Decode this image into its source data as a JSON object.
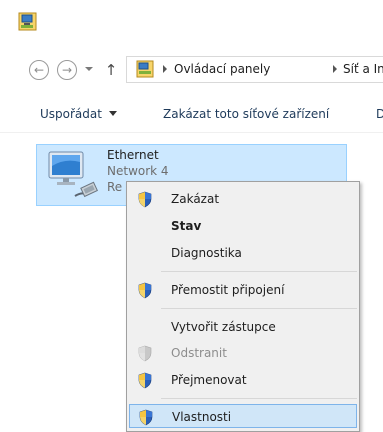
{
  "address": {
    "crumbs": [
      "Ovládací panely",
      "Síť a Int"
    ]
  },
  "commandbar": {
    "organize_label": "Uspořádat",
    "disable_label": "Zakázat toto síťové zařízení",
    "more_label": "D"
  },
  "adapter": {
    "name": "Ethernet",
    "network": "Network  4",
    "status": "Re"
  },
  "context_menu": {
    "items": [
      {
        "label": "Zakázat",
        "shield": true,
        "bold": false,
        "disabled": false
      },
      {
        "label": "Stav",
        "shield": false,
        "bold": true,
        "disabled": false
      },
      {
        "label": "Diagnostika",
        "shield": false,
        "bold": false,
        "disabled": false
      },
      {
        "label": "Přemostit připojení",
        "shield": true,
        "bold": false,
        "disabled": false
      },
      {
        "label": "Vytvořit zástupce",
        "shield": false,
        "bold": false,
        "disabled": false
      },
      {
        "label": "Odstranit",
        "shield": true,
        "bold": false,
        "disabled": true
      },
      {
        "label": "Přejmenovat",
        "shield": true,
        "bold": false,
        "disabled": false
      },
      {
        "label": "Vlastnosti",
        "shield": true,
        "bold": false,
        "disabled": false,
        "highlighted": true
      }
    ]
  },
  "icons": {
    "title": "network-connections-icon",
    "back": "back-arrow-icon",
    "forward": "forward-arrow-icon",
    "recent": "recent-locations-icon",
    "up": "up-arrow-icon",
    "address": "control-panel-icon",
    "adapter": "ethernet-adapter-icon",
    "shield": "uac-shield-icon"
  },
  "colors": {
    "selection": "#cce8ff",
    "selection_border": "#99d1ff",
    "menu_bg": "#f0f0f0",
    "menu_hover": "#d0e6f8",
    "menu_hover_border": "#7eb4ea"
  }
}
